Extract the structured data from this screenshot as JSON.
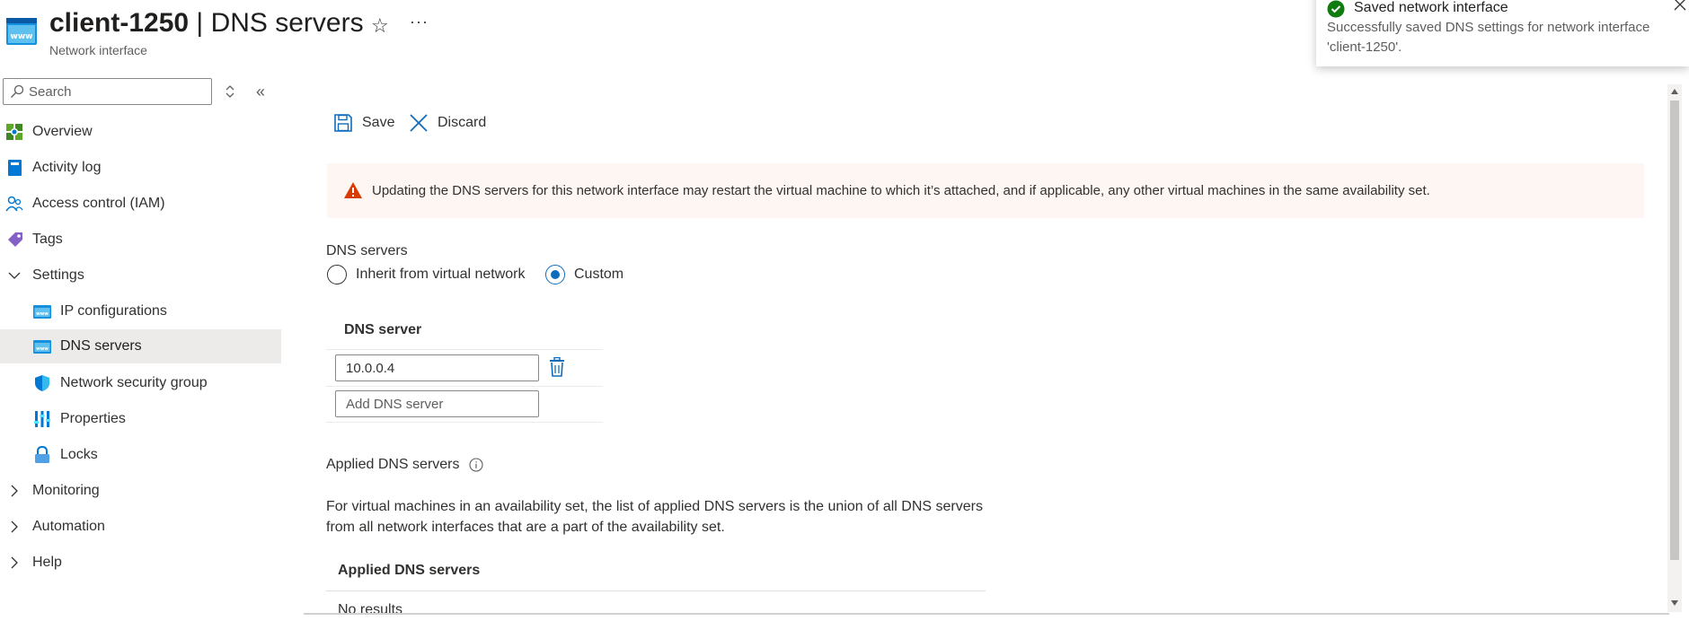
{
  "header": {
    "resource_name": "client-1250",
    "separator": " | ",
    "page_name": "DNS servers",
    "subtitle": "Network interface",
    "icon": "network-interface-icon",
    "favorite_icon": "star-icon",
    "more_icon": "more-ellipsis-icon"
  },
  "sidebar": {
    "search_placeholder": "Search",
    "items": [
      {
        "label": "Overview",
        "icon": "overview-icon"
      },
      {
        "label": "Activity log",
        "icon": "activity-log-icon"
      },
      {
        "label": "Access control (IAM)",
        "icon": "iam-icon"
      },
      {
        "label": "Tags",
        "icon": "tag-icon"
      },
      {
        "label": "Settings",
        "icon": "chevron-down-icon",
        "expanded": true
      },
      {
        "label": "IP configurations",
        "icon": "ip-config-icon"
      },
      {
        "label": "DNS servers",
        "icon": "dns-icon",
        "selected": true
      },
      {
        "label": "Network security group",
        "icon": "shield-icon"
      },
      {
        "label": "Properties",
        "icon": "properties-icon"
      },
      {
        "label": "Locks",
        "icon": "lock-icon"
      },
      {
        "label": "Monitoring",
        "icon": "chevron-right-icon"
      },
      {
        "label": "Automation",
        "icon": "chevron-right-icon"
      },
      {
        "label": "Help",
        "icon": "chevron-right-icon"
      }
    ]
  },
  "toolbar": {
    "save_label": "Save",
    "discard_label": "Discard"
  },
  "warning": {
    "text": "Updating the DNS servers for this network interface may restart the virtual machine to which it’s attached, and if applicable, any other virtual machines in the same availability set."
  },
  "dns": {
    "section_label": "DNS servers",
    "option_inherit": "Inherit from virtual network",
    "option_custom": "Custom",
    "selected_option": "Custom",
    "column_header": "DNS server",
    "servers": [
      "10.0.0.4"
    ],
    "add_placeholder": "Add DNS server"
  },
  "applied": {
    "title": "Applied DNS servers",
    "description": "For virtual machines in an availability set, the list of applied DNS servers is the union of all DNS servers from all network interfaces that are a part of the availability set.",
    "table_header": "Applied DNS servers",
    "empty_text": "No results"
  },
  "toast": {
    "title": "Saved network interface",
    "message": "Successfully saved DNS settings for network interface 'client-1250'.",
    "status_color": "#107c10"
  },
  "colors": {
    "accent": "#0f6cbd",
    "warning_bg": "#fdf6f2",
    "warning_icon": "#d83b01",
    "selected_bg": "#edebe9"
  }
}
